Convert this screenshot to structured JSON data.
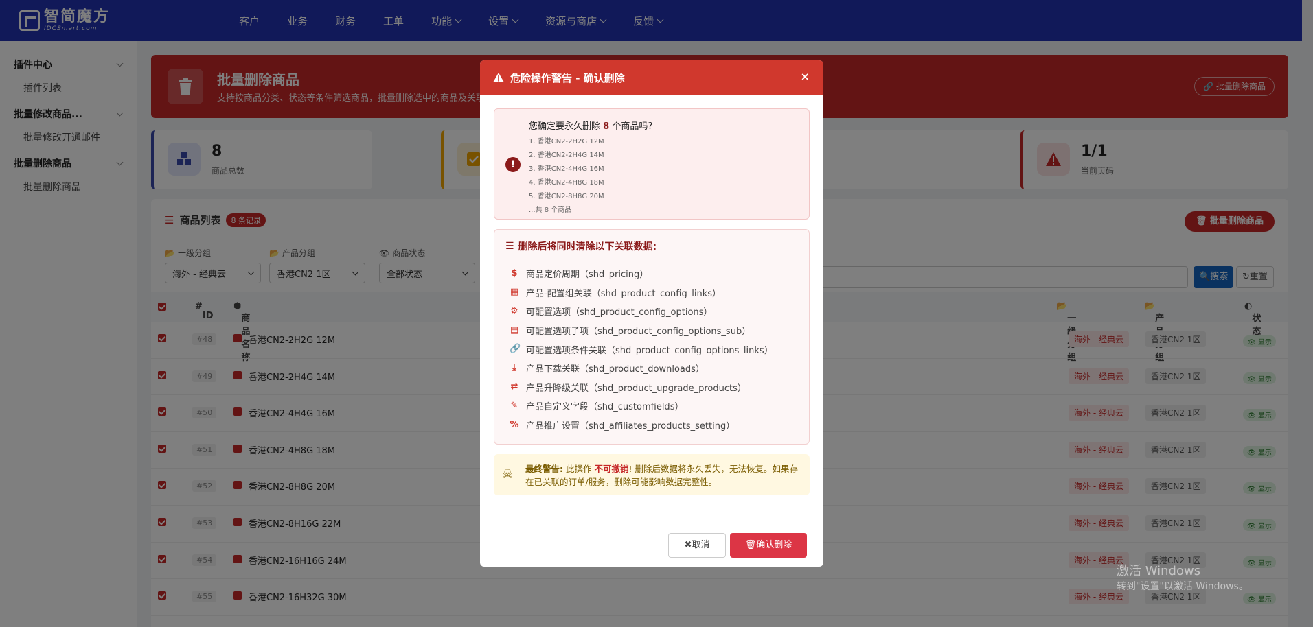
{
  "header": {
    "logo_name": "智简魔方",
    "logo_sub": "IDCSmart.com",
    "nav": [
      {
        "label": "客户",
        "dropdown": false
      },
      {
        "label": "业务",
        "dropdown": false
      },
      {
        "label": "财务",
        "dropdown": false
      },
      {
        "label": "工单",
        "dropdown": false
      },
      {
        "label": "功能",
        "dropdown": true
      },
      {
        "label": "设置",
        "dropdown": true
      },
      {
        "label": "资源与商店",
        "dropdown": true
      },
      {
        "label": "反馈",
        "dropdown": true
      }
    ]
  },
  "sidebar": {
    "groups": [
      {
        "label": "插件中心",
        "item": "插件列表"
      },
      {
        "label": "批量修改商品...",
        "item": "批量修改开通邮件"
      },
      {
        "label": "批量删除商品",
        "item": "批量删除商品"
      }
    ]
  },
  "banner": {
    "title": "批量删除商品",
    "subtitle": "支持按商品分类、状态等条件筛选商品，批量删除选中的商品及关联",
    "button": "批量删除商品"
  },
  "stats": [
    {
      "value": "8",
      "label": "商品总数"
    },
    {
      "value": "1/1",
      "label": "当前页码"
    }
  ],
  "panel": {
    "title": "商品列表",
    "count_badge": "8 条记录",
    "bulk_delete": "批量删除商品",
    "filters": [
      {
        "label": "一级分组",
        "value": "海外 - 经典云"
      },
      {
        "label": "产品分组",
        "value": "香港CN2 1区"
      },
      {
        "label": "商品状态",
        "value": "全部状态"
      }
    ],
    "search": "搜索",
    "reset": "重置",
    "columns": {
      "id": "ID",
      "name": "商品名称",
      "group1": "一级分组",
      "group2": "产品分组",
      "status": "状态"
    },
    "rows": [
      {
        "id": "#48",
        "name": "香港CN2-2H2G 12M",
        "group1": "海外 - 经典云",
        "group2": "香港CN2 1区",
        "status": "显示"
      },
      {
        "id": "#49",
        "name": "香港CN2-2H4G 14M",
        "group1": "海外 - 经典云",
        "group2": "香港CN2 1区",
        "status": "显示"
      },
      {
        "id": "#50",
        "name": "香港CN2-4H4G 16M",
        "group1": "海外 - 经典云",
        "group2": "香港CN2 1区",
        "status": "显示"
      },
      {
        "id": "#51",
        "name": "香港CN2-4H8G 18M",
        "group1": "海外 - 经典云",
        "group2": "香港CN2 1区",
        "status": "显示"
      },
      {
        "id": "#52",
        "name": "香港CN2-8H8G 20M",
        "group1": "海外 - 经典云",
        "group2": "香港CN2 1区",
        "status": "显示"
      },
      {
        "id": "#53",
        "name": "香港CN2-8H16G 22M",
        "group1": "海外 - 经典云",
        "group2": "香港CN2 1区",
        "status": "显示"
      },
      {
        "id": "#54",
        "name": "香港CN2-16H16G 24M",
        "group1": "海外 - 经典云",
        "group2": "香港CN2 1区",
        "status": "显示"
      },
      {
        "id": "#55",
        "name": "香港CN2-16H32G 30M",
        "group1": "海外 - 经典云",
        "group2": "香港CN2 1区",
        "status": "显示"
      }
    ]
  },
  "modal": {
    "title": "危险操作警告 - 确认删除",
    "question_prefix": "您确定要永久删除 ",
    "question_count": "8",
    "question_suffix": " 个商品吗?",
    "products": [
      "1. 香港CN2-2H2G 12M",
      "2. 香港CN2-2H4G 14M",
      "3. 香港CN2-4H4G 16M",
      "4. 香港CN2-4H8G 18M",
      "5. 香港CN2-8H8G 20M"
    ],
    "products_more": "...共 8 个商品",
    "cleanup_title": "删除后将同时清除以下关联数据:",
    "cleanup": [
      {
        "icon": "dollar-icon",
        "text": "商品定价周期（shd_pricing）"
      },
      {
        "icon": "grid-icon",
        "text": "产品-配置组关联（shd_product_config_links）"
      },
      {
        "icon": "cogs-icon",
        "text": "可配置选项（shd_product_config_options）"
      },
      {
        "icon": "list-alt-icon",
        "text": "可配置选项子项（shd_product_config_options_sub）"
      },
      {
        "icon": "link-icon",
        "text": "可配置选项条件关联（shd_product_config_options_links）"
      },
      {
        "icon": "download-icon",
        "text": "产品下载关联（shd_product_downloads）"
      },
      {
        "icon": "exchange-icon",
        "text": "产品升降级关联（shd_product_upgrade_products）"
      },
      {
        "icon": "pencil-icon",
        "text": "产品自定义字段（shd_customfields）"
      },
      {
        "icon": "percent-icon",
        "text": "产品推广设置（shd_affiliates_products_setting）"
      }
    ],
    "warn_label": "最终警告:",
    "warn_pre": " 此操作 ",
    "warn_hl": "不可撤销",
    "warn_post": "! 删除后数据将永久丢失，无法恢复。如果存在已关联的订单/服务，删除可能影响数据完整性。",
    "cancel": "取消",
    "confirm": "确认删除"
  },
  "watermark": {
    "line1": "激活 Windows",
    "line2": "转到\"设置\"以激活 Windows。"
  }
}
